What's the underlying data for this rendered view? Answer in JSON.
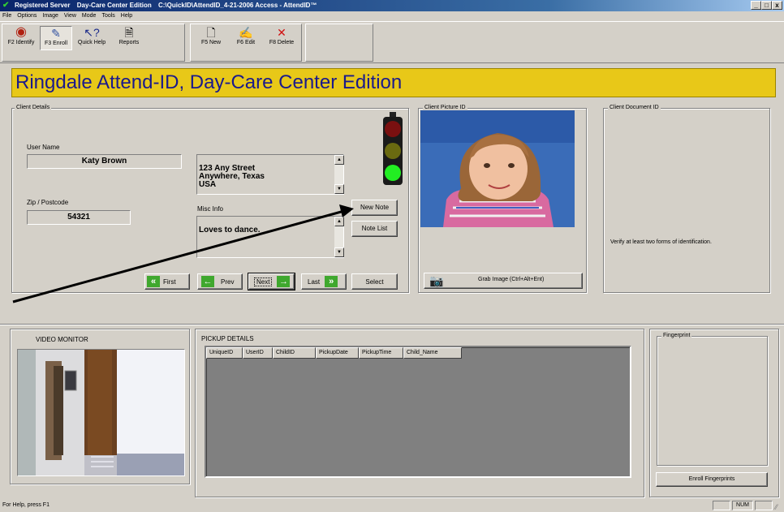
{
  "window": {
    "title_parts": [
      "Registered Server",
      "Day-Care Center Edition",
      "C:\\QuickID\\AttendID_4-21-2006 Access - AttendID™"
    ],
    "controls": [
      "_",
      "□",
      "x"
    ]
  },
  "menu": [
    "File",
    "Options",
    "Image",
    "View",
    "Mode",
    "Tools",
    "Help"
  ],
  "toolbar": {
    "identify": "F2 Identify",
    "enroll": "F3 Enroll",
    "quick_help": "Quick Help",
    "reports": "Reports",
    "new": "F5 New",
    "edit": "F6 Edit",
    "delete": "F8 Delete"
  },
  "banner": {
    "title": "Ringdale Attend-ID, Day-Care Center Edition",
    "color": "#e8c818",
    "text_color": "#1a1a8c"
  },
  "client_details": {
    "group_label": "Client Details",
    "user_name_label": "User Name",
    "user_name": "Katy Brown",
    "zip_label": "Zip / Postcode",
    "zip": "54321",
    "address": "123 Any Street\nAnywhere, Texas\nUSA",
    "misc_label": "Misc Info",
    "misc": "Loves to dance.",
    "new_note": "New Note",
    "note_list": "Note List",
    "nav": {
      "first": "First",
      "prev": "Prev",
      "next": "Next",
      "last": "Last",
      "select": "Select"
    },
    "traffic_light": {
      "red": "#7a1010",
      "yellow": "#6a6a10",
      "green": "#22ee22"
    }
  },
  "picture": {
    "group_label": "Client Picture ID",
    "grab_button": "Grab Image (Ctrl+Alt+Ent)"
  },
  "document": {
    "group_label": "Client Document ID",
    "note": "Verify at least two forms of identification."
  },
  "video": {
    "label": "VIDEO MONITOR"
  },
  "pickup": {
    "label": "PICKUP DETAILS",
    "columns": [
      "UniqueID",
      "UserID",
      "ChildID",
      "PickupDate",
      "PickupTime",
      "Child_Name"
    ]
  },
  "fingerprint": {
    "group_label": "Fingerprint",
    "enroll_button": "Enroll Fingerprints"
  },
  "status": {
    "help": "For Help, press F1",
    "num": "NUM"
  }
}
